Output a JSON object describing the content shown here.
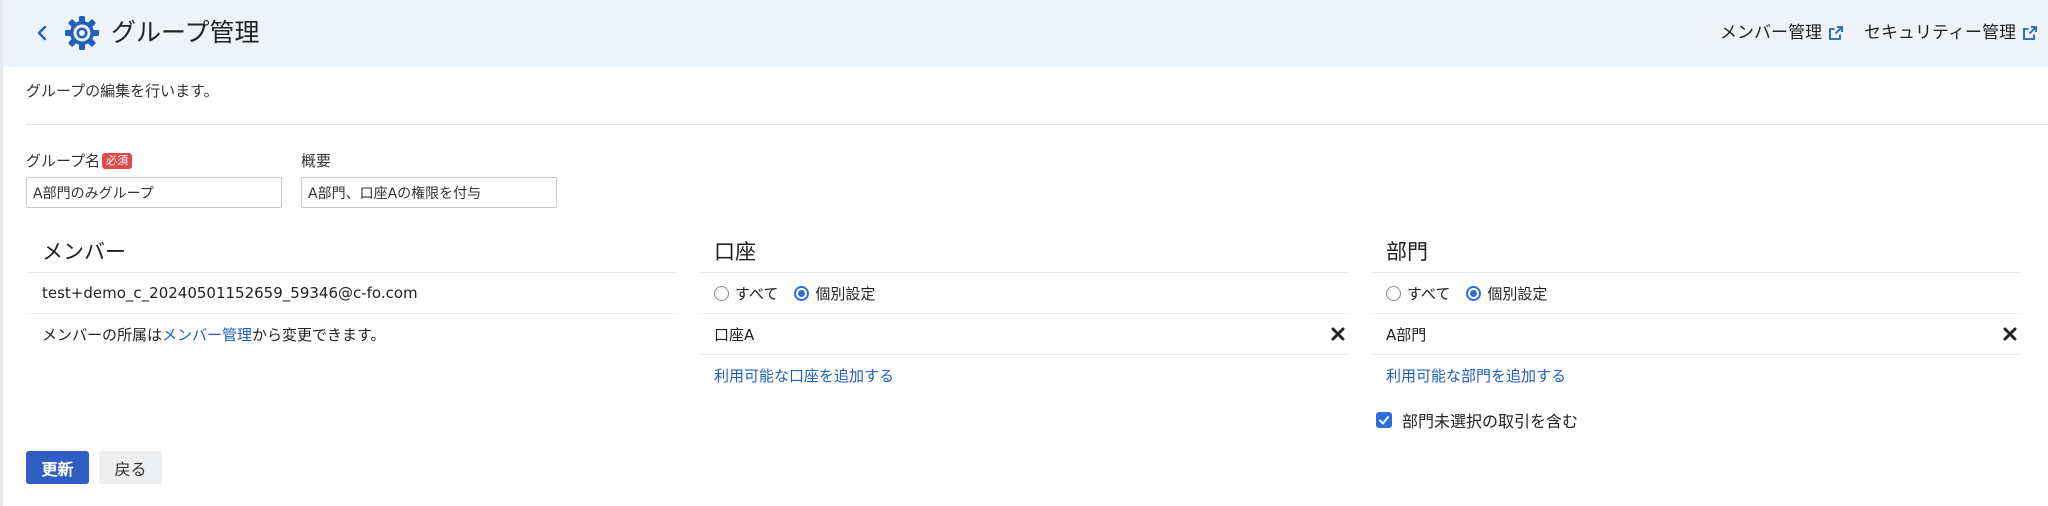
{
  "header": {
    "back_icon": "chevron-left-icon",
    "title_icon": "gear-icon",
    "title": "グループ管理",
    "links": [
      {
        "label": "メンバー管理",
        "icon": "external-link-icon"
      },
      {
        "label": "セキュリティー管理",
        "icon": "external-link-icon"
      }
    ],
    "accent_color": "#1f5fbf",
    "background_color": "#eef2fb"
  },
  "description": "グループの編集を行います。",
  "form": {
    "group_name": {
      "label": "グループ名",
      "required_badge": "必須",
      "value": "A部門のみグループ"
    },
    "summary": {
      "label": "概要",
      "value": "A部門、口座Aの権限を付与"
    }
  },
  "members": {
    "title": "メンバー",
    "items": [
      "test+demo_c_20240501152659_59346@c-fo.com"
    ],
    "note_prefix": "メンバーの所属は",
    "note_link": "メンバー管理",
    "note_suffix": "から変更できます。"
  },
  "accounts": {
    "title": "口座",
    "radio_options": [
      {
        "label": "すべて",
        "checked": false
      },
      {
        "label": "個別設定",
        "checked": true
      }
    ],
    "items": [
      "口座A"
    ],
    "add_link": "利用可能な口座を追加する"
  },
  "departments": {
    "title": "部門",
    "radio_options": [
      {
        "label": "すべて",
        "checked": false
      },
      {
        "label": "個別設定",
        "checked": true
      }
    ],
    "items": [
      "A部門"
    ],
    "add_link": "利用可能な部門を追加する",
    "include_unselected": {
      "label": "部門未選択の取引を含む",
      "checked": true
    }
  },
  "buttons": {
    "update": "更新",
    "back": "戻る"
  }
}
